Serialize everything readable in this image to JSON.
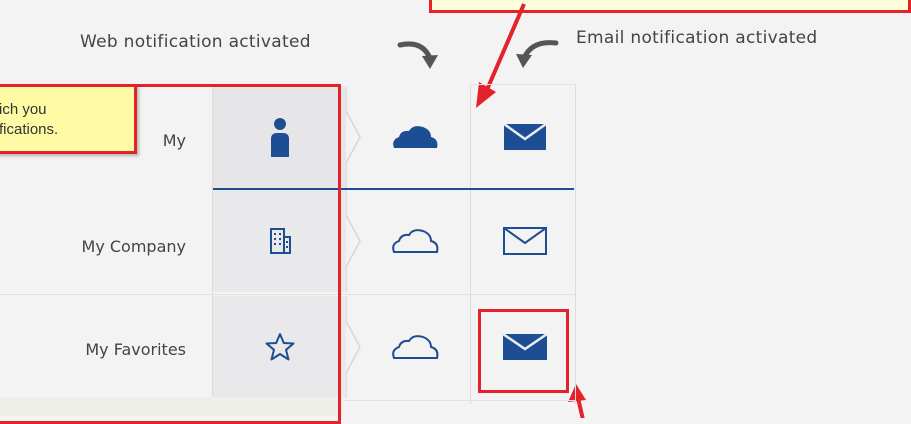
{
  "header": {
    "web_label": "Web notification activated",
    "email_label": "Email notification activated"
  },
  "note": {
    "line1": "ich you",
    "line2": "fications."
  },
  "rows": [
    {
      "label": "My",
      "icon": "person-icon",
      "web": "filled",
      "email": "filled",
      "selected": true
    },
    {
      "label": "My Company",
      "icon": "building-icon",
      "web": "outline",
      "email": "outline",
      "selected": false
    },
    {
      "label": "My Favorites",
      "icon": "star-icon",
      "web": "outline",
      "email": "filled",
      "selected": false
    }
  ],
  "colors": {
    "accent_blue": "#1d4e93",
    "annotation_red": "#e3222a",
    "note_yellow": "#fffaa4"
  }
}
